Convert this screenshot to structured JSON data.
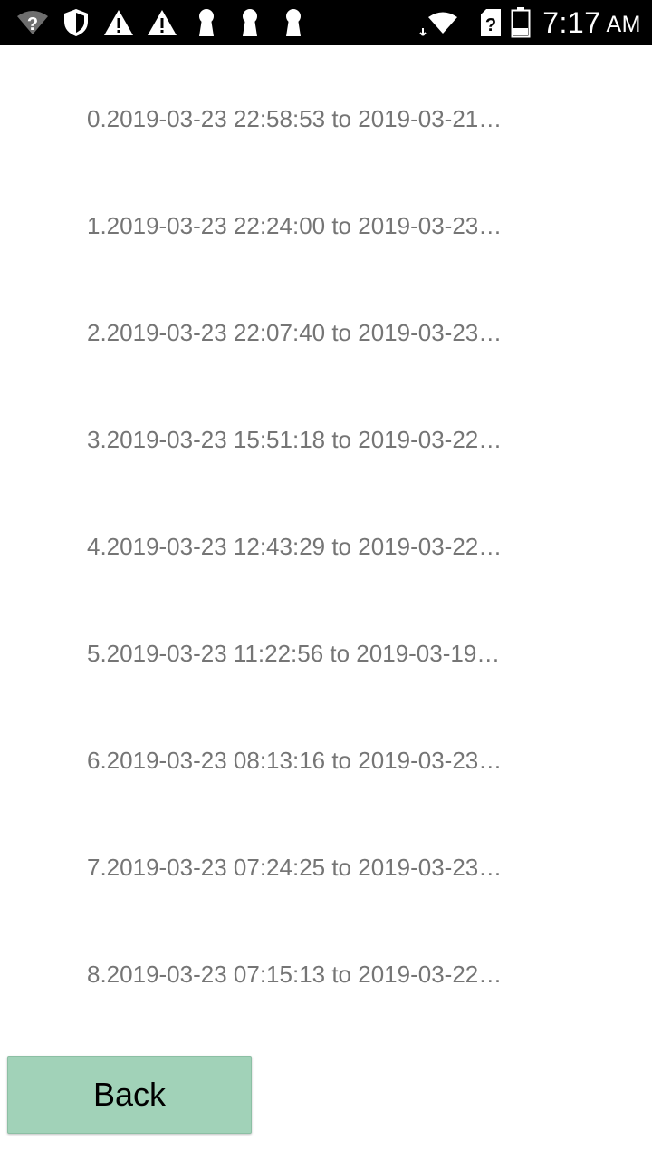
{
  "status_bar": {
    "time": "7:17",
    "ampm": "AM",
    "icons": [
      "wifi-unknown-icon",
      "shield-icon",
      "warning-icon",
      "warning-icon",
      "keyhole-icon",
      "keyhole-icon",
      "keyhole-icon",
      "wifi-icon",
      "sim-unknown-icon",
      "battery-icon"
    ]
  },
  "list": {
    "items": [
      {
        "label": "0.2019-03-23 22:58:53 to 2019-03-21…"
      },
      {
        "label": "1.2019-03-23 22:24:00 to 2019-03-23…"
      },
      {
        "label": "2.2019-03-23 22:07:40 to 2019-03-23…"
      },
      {
        "label": "3.2019-03-23 15:51:18 to 2019-03-22…"
      },
      {
        "label": "4.2019-03-23 12:43:29 to 2019-03-22…"
      },
      {
        "label": "5.2019-03-23 11:22:56 to 2019-03-19…"
      },
      {
        "label": "6.2019-03-23 08:13:16 to 2019-03-23…"
      },
      {
        "label": "7.2019-03-23 07:24:25 to 2019-03-23…"
      },
      {
        "label": "8.2019-03-23 07:15:13 to 2019-03-22…"
      }
    ]
  },
  "back_button": {
    "label": "Back"
  },
  "colors": {
    "status_bar_bg": "#000000",
    "list_text": "#757575",
    "button_bg": "#a1d2b8"
  }
}
